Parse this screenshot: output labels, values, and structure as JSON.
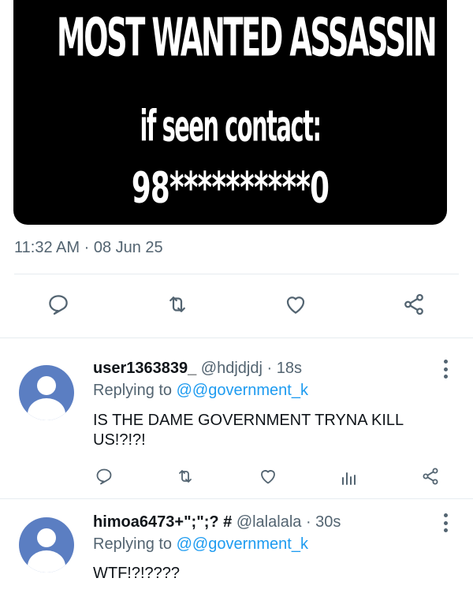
{
  "tweet": {
    "image_text": {
      "line1": "MOST WANTED ASSASSIN",
      "line2": "if seen contact:",
      "line3": "98**********0"
    },
    "time": "11:32 AM",
    "separator": "·",
    "date": "08 Jun 25",
    "actions": [
      "reply-icon",
      "retweet-icon",
      "like-icon",
      "share-icon"
    ]
  },
  "replies": [
    {
      "username": "user1363839_",
      "handle": "@hdjdjdj",
      "age": "· 18s",
      "replying_label": "Replying to",
      "replying_to": "@@government_k",
      "text": "IS THE DAME GOVERNMENT TRYNA KILL US!?!?!",
      "actions": [
        "reply-icon",
        "retweet-icon",
        "like-icon",
        "analytics-icon",
        "share-icon"
      ]
    },
    {
      "username": "himoa6473+\";\";? #",
      "handle": "@lalalala",
      "age": "· 30s",
      "replying_label": "Replying to",
      "replying_to": "@@government_k",
      "text": "WTF!?!????"
    }
  ],
  "colors": {
    "text": "#0f1419",
    "muted": "#536471",
    "link": "#1d9bf0",
    "avatar": "#5b7ec2",
    "divider": "#e6ecf0"
  }
}
